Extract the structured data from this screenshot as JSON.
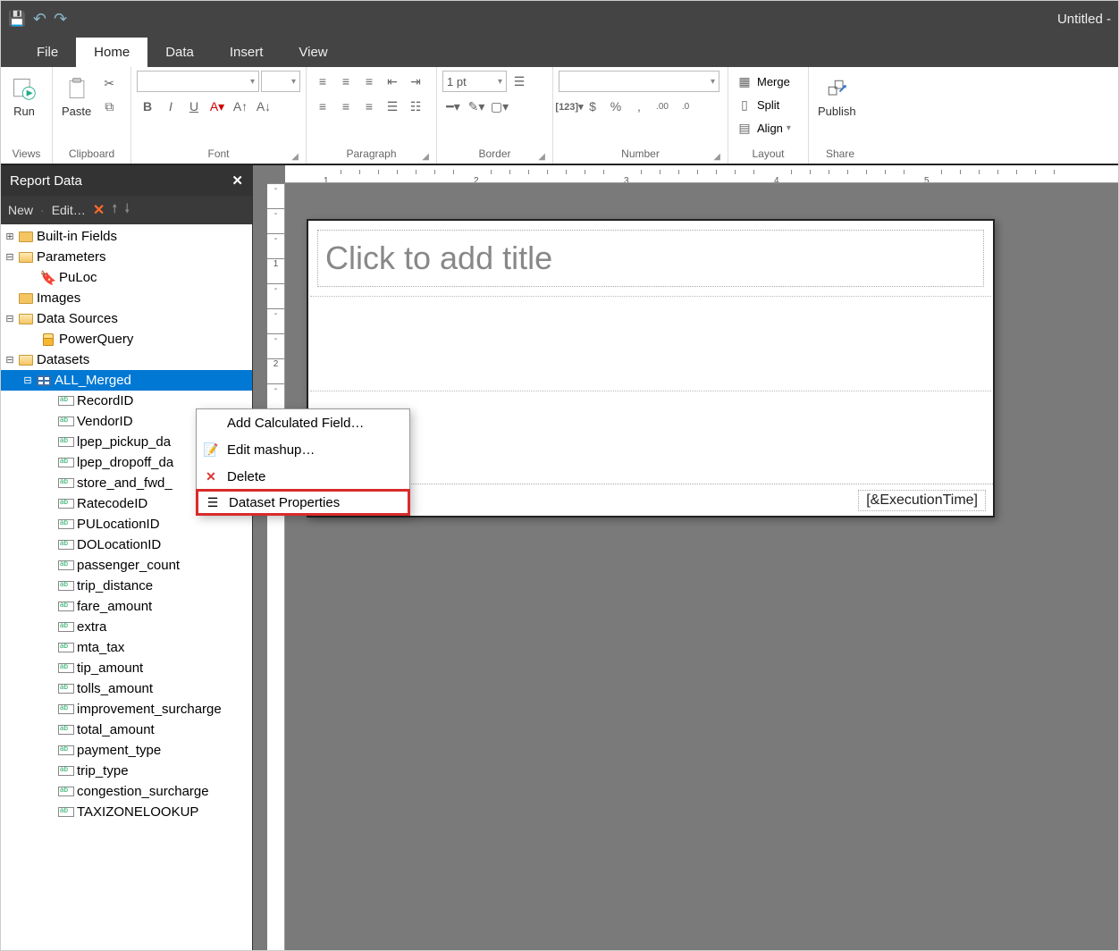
{
  "window": {
    "title": "Untitled -"
  },
  "qat": {
    "save": "save-icon",
    "undo": "undo-icon",
    "redo": "redo-icon"
  },
  "menus": [
    "File",
    "Home",
    "Data",
    "Insert",
    "View"
  ],
  "active_menu": "Home",
  "ribbon": {
    "views": {
      "run": "Run",
      "label": "Views"
    },
    "clipboard": {
      "paste": "Paste",
      "label": "Clipboard"
    },
    "font": {
      "bold": "B",
      "italic": "I",
      "underline": "U",
      "label": "Font"
    },
    "paragraph": {
      "label": "Paragraph"
    },
    "border": {
      "width": "1 pt",
      "label": "Border"
    },
    "number": {
      "label": "Number"
    },
    "layout": {
      "merge": "Merge",
      "split": "Split",
      "align": "Align",
      "label": "Layout"
    },
    "share": {
      "publish": "Publish",
      "label": "Share"
    }
  },
  "report_data": {
    "title": "Report Data",
    "toolbar": {
      "new": "New",
      "edit": "Edit…"
    },
    "tree": {
      "builtins": "Built-in Fields",
      "parameters": "Parameters",
      "param_items": [
        "PuLoc"
      ],
      "images": "Images",
      "datasources": "Data Sources",
      "ds_items": [
        "PowerQuery"
      ],
      "datasets": "Datasets",
      "dataset_name": "ALL_Merged",
      "fields": [
        "RecordID",
        "VendorID",
        "lpep_pickup_da",
        "lpep_dropoff_da",
        "store_and_fwd_",
        "RatecodeID",
        "PULocationID",
        "DOLocationID",
        "passenger_count",
        "trip_distance",
        "fare_amount",
        "extra",
        "mta_tax",
        "tip_amount",
        "tolls_amount",
        "improvement_surcharge",
        "total_amount",
        "payment_type",
        "trip_type",
        "congestion_surcharge",
        "TAXIZONELOOKUP"
      ]
    }
  },
  "context_menu": {
    "items": [
      "Add Calculated Field…",
      "Edit mashup…",
      "Delete",
      "Dataset Properties"
    ],
    "highlighted_index": 3
  },
  "canvas": {
    "title_placeholder": "Click to add title",
    "footer": "[&ExecutionTime]"
  },
  "ruler_majors": [
    "1",
    "2",
    "3",
    "4",
    "5"
  ]
}
